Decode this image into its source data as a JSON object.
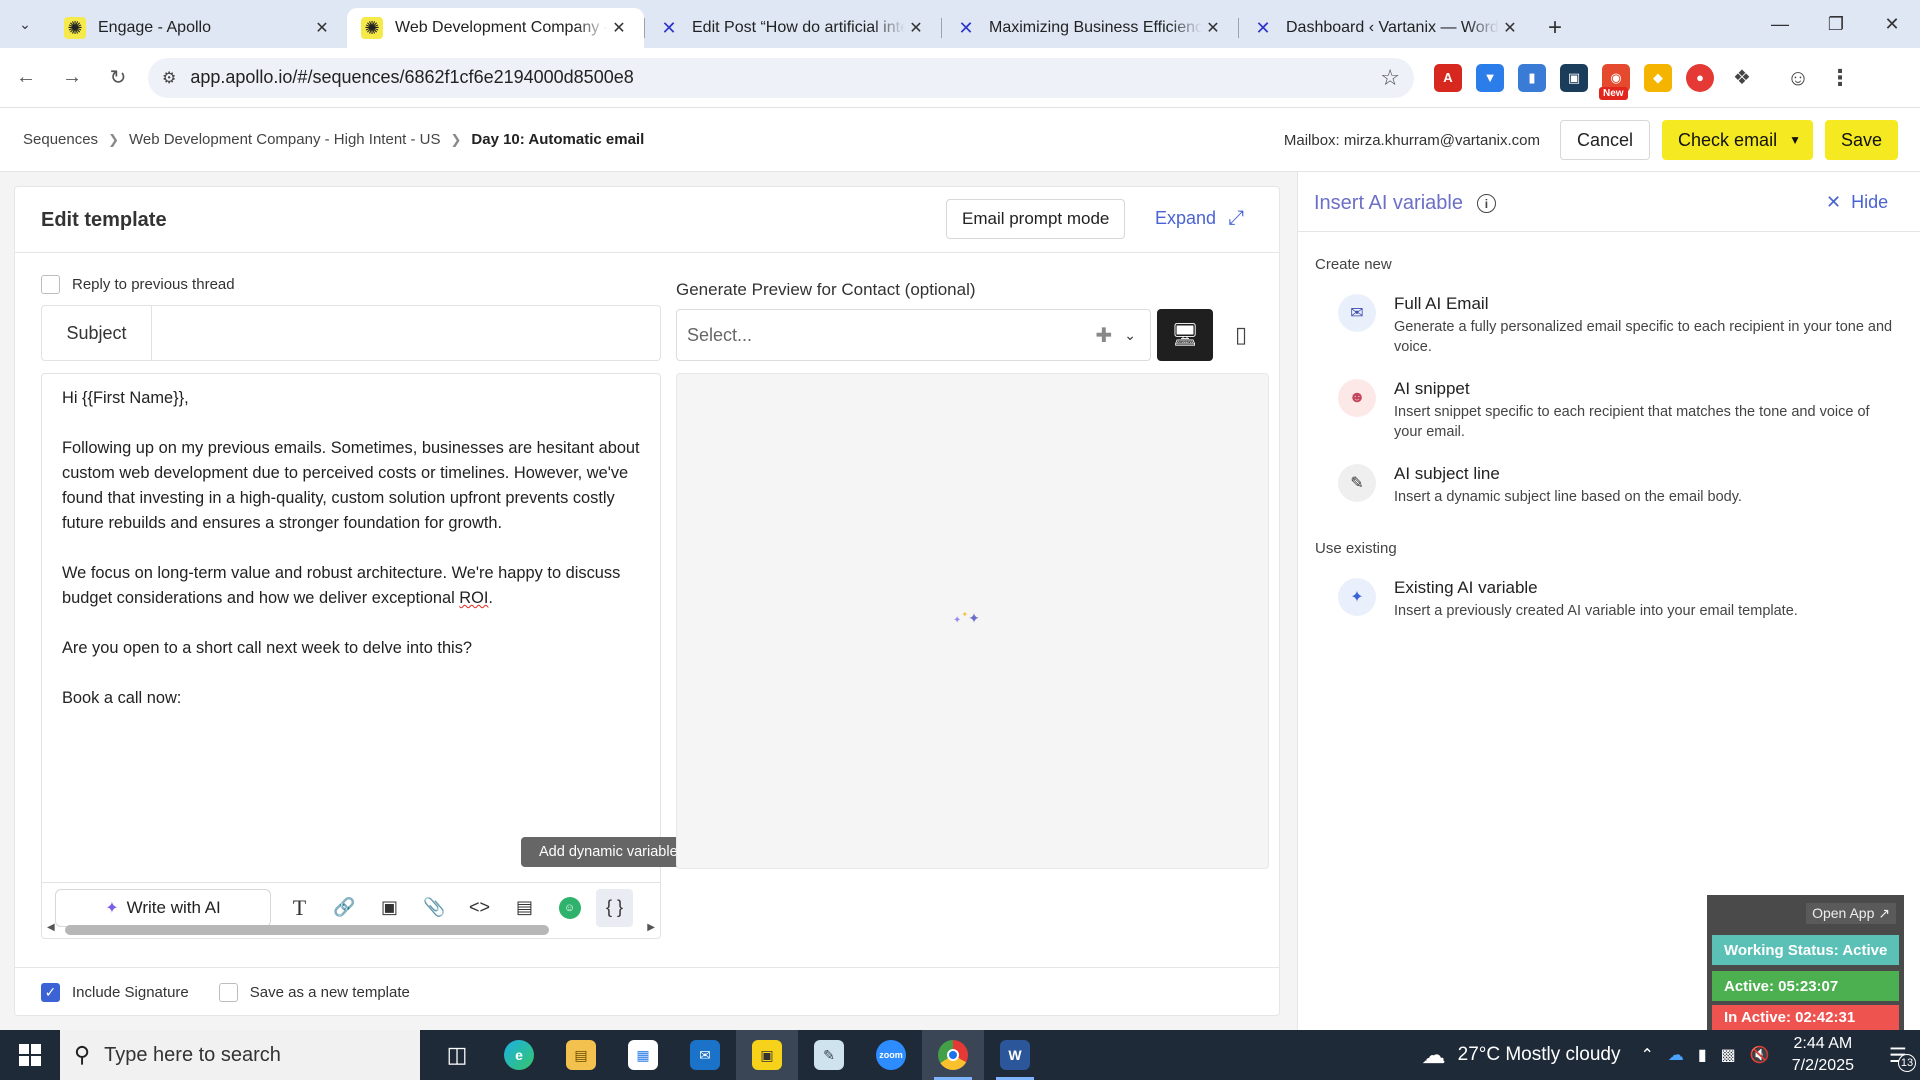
{
  "browser": {
    "tabs": [
      {
        "title": "Engage - Apollo",
        "favicon": "apollo-icon",
        "active": false
      },
      {
        "title": "Web Development Company - High Intent",
        "favicon": "apollo-icon",
        "active": true
      },
      {
        "title": "Edit Post “How do artificial intelligence",
        "favicon": "x-icon",
        "active": false
      },
      {
        "title": "Maximizing Business Efficiency",
        "favicon": "x-icon",
        "active": false
      },
      {
        "title": "Dashboard ‹ Vartanix — WordPress",
        "favicon": "x-icon",
        "active": false
      }
    ],
    "url": "app.apollo.io/#/sequences/6862f1cf6e2194000d8500e8",
    "new_badge": "New"
  },
  "header": {
    "breadcrumb": [
      "Sequences",
      "Web Development Company - High Intent - US",
      "Day 10: Automatic email"
    ],
    "mailbox": "Mailbox: mirza.khurram@vartanix.com",
    "cancel_label": "Cancel",
    "check_email_label": "Check email",
    "save_label": "Save"
  },
  "editor": {
    "title": "Edit template",
    "prompt_mode_label": "Email prompt mode",
    "expand_label": "Expand",
    "reply_label": "Reply to previous thread",
    "reply_checked": false,
    "subject_label": "Subject",
    "subject_value": "",
    "body": {
      "greeting": "Hi {{First Name}},",
      "p1": "Following up on my previous emails. Sometimes, businesses are hesitant about custom web development due to perceived costs or timelines. However, we've found that investing in a high-quality, custom solution upfront prevents costly future rebuilds and ensures a stronger foundation for growth.",
      "p2_start": "We focus on long-term value and robust architecture. We're happy to discuss budget considerations and how we deliver exceptional ",
      "p2_roi": "ROI",
      "p2_end": ".",
      "p3": "Are you open to a short call next week to delve into this?",
      "p4": "Book a call now:"
    },
    "tooltip": "Add dynamic variables",
    "write_ai_label": "Write with AI",
    "preview_label": "Generate Preview for Contact (optional)",
    "contact_placeholder": "Select...",
    "include_signature_label": "Include Signature",
    "include_signature_checked": true,
    "save_template_label": "Save as a new template",
    "save_template_checked": false
  },
  "ai_panel": {
    "title": "Insert AI variable",
    "hide_label": "Hide",
    "create_new_label": "Create new",
    "use_existing_label": "Use existing",
    "items": [
      {
        "title": "Full AI Email",
        "desc": "Generate a fully personalized email specific to each recipient in your tone and voice.",
        "icon": "email-sparkle-icon",
        "color": "#eaf0fb"
      },
      {
        "title": "AI snippet",
        "desc": "Insert snippet specific to each recipient that matches the tone and voice of your email.",
        "icon": "person-sparkle-icon",
        "color": "#fde8e8"
      },
      {
        "title": "AI subject line",
        "desc": "Insert a dynamic subject line based on the email body.",
        "icon": "subject-sparkle-icon",
        "color": "#efefef"
      },
      {
        "title": "Existing AI variable",
        "desc": "Insert a previously created AI variable into your email template.",
        "icon": "sparkle-icon",
        "color": "#eaf0fb"
      }
    ]
  },
  "tracker": {
    "open_app": "Open App ↗",
    "status": "Working Status: Active",
    "active": "Active: 05:23:07",
    "inactive": "In Active: 02:42:31"
  },
  "taskbar": {
    "search_placeholder": "Type here to search",
    "weather": "27°C  Mostly cloudy",
    "time": "2:44 AM",
    "date": "7/2/2025",
    "notifications": "13"
  },
  "colors": {
    "accent_yellow": "#f5ea21",
    "link_blue": "#4a63d3",
    "panel_title": "#6b6fc8"
  }
}
